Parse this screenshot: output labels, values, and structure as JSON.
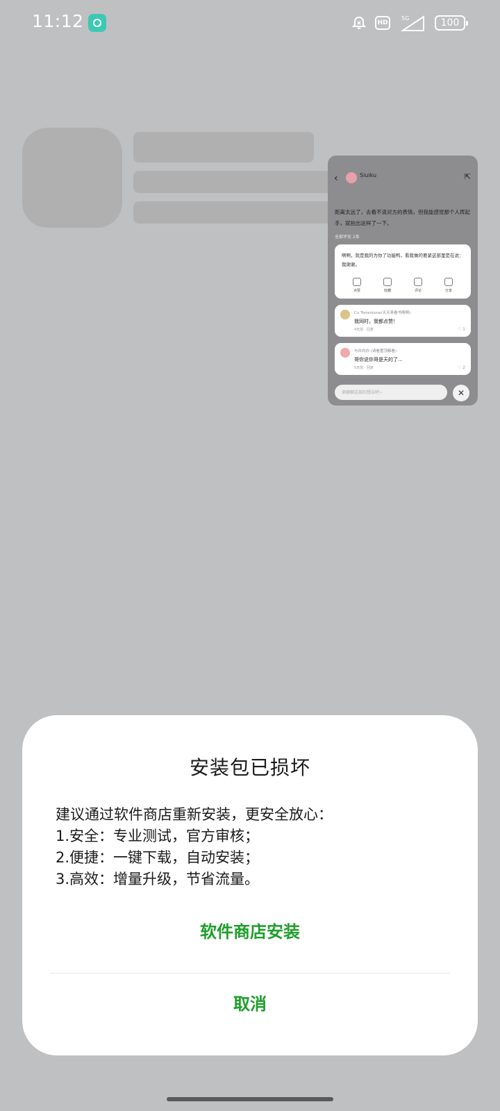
{
  "status_bar": {
    "time": "11:12",
    "battery": "100",
    "network": "5G",
    "hd_label": "HD",
    "icons": [
      "app-notification-icon",
      "bell-muted-icon",
      "hd-icon",
      "signal-icon",
      "battery-icon"
    ]
  },
  "preview": {
    "username": "Siuiku",
    "post_text": "距离太远了，去看不清对方的表情，但我能感觉那个人挥起手，就拍出这样了一下。",
    "comment_count_label": "全部评论 2条",
    "reply_text": "啊啊，就是我的为你了功能鸭，看我做的要紧这部里是在说：我谢谢。",
    "actions": [
      "点赞",
      "收藏",
      "评论",
      "分享"
    ],
    "comments": [
      {
        "name": "Cu Torrentone(天天来看书啊啊)",
        "body": "我同时，我都点赞！",
        "meta": "4天前 · 回复",
        "likes": "1"
      },
      {
        "name": "与白白白 (请看置顶都看)",
        "body": "哥你说你哥是天的了...",
        "meta": "5天前 · 回复",
        "likes": "2"
      }
    ],
    "input_placeholder": "来聊聊这部的想法吧~"
  },
  "dialog": {
    "title": "安装包已损坏",
    "body_lines": [
      "建议通过软件商店重新安装，更安全放心：",
      "1.安全：专业测试，官方审核；",
      "2.便捷：一键下载，自动安装；",
      "3.高效：增量升级，节省流量。"
    ],
    "primary_button": "软件商店安装",
    "cancel_button": "取消",
    "accent_color": "#1d9e2a"
  }
}
